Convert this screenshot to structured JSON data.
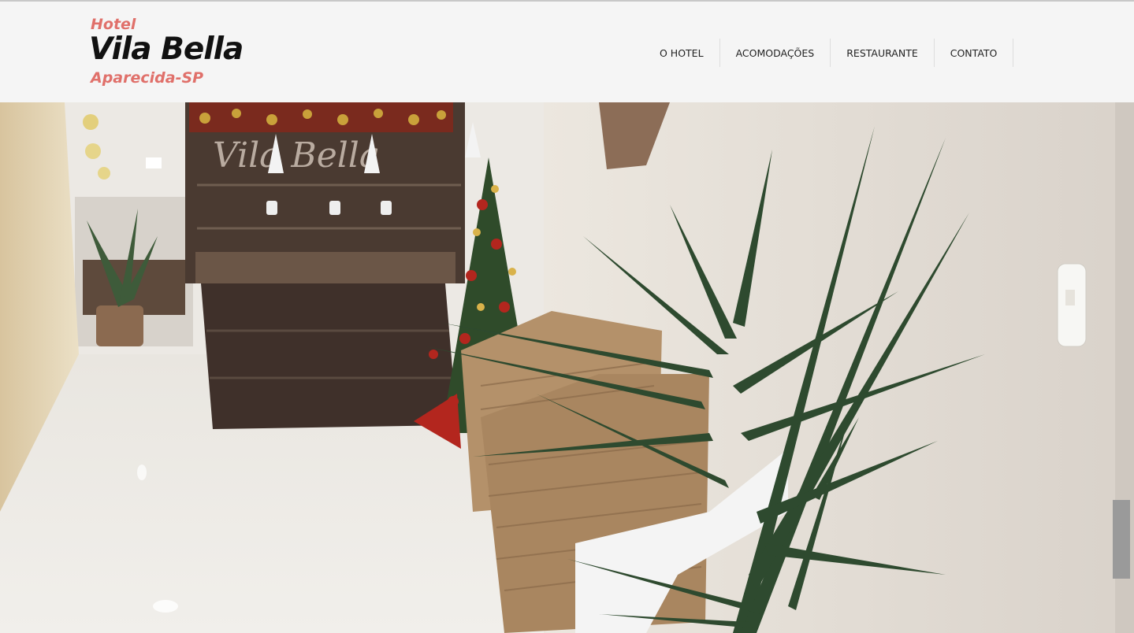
{
  "logo": {
    "line1": "Hotel",
    "line2": "Vila Bella",
    "line3": "Aparecida-SP"
  },
  "nav": {
    "items": [
      {
        "label": "O HOTEL"
      },
      {
        "label": "ACOMODAÇÕES"
      },
      {
        "label": "RESTAURANTE"
      },
      {
        "label": "CONTATO"
      }
    ]
  },
  "hero": {
    "sign_text": "Vila Bella"
  },
  "colors": {
    "accent": "#e0706a",
    "header_bg": "#f5f5f5"
  }
}
